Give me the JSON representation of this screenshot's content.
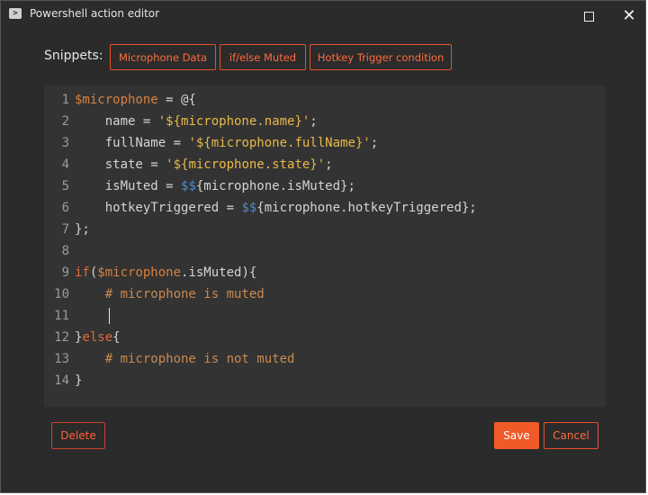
{
  "window": {
    "title": "Powershell action editor",
    "app_icon": "powershell-icon",
    "maximize_icon": "maximize-icon",
    "close_icon": "close-icon",
    "close_glyph": "✕"
  },
  "snippets": {
    "label": "Snippets:",
    "buttons": [
      "Microphone Data",
      "if/else Muted",
      "Hotkey Trigger condition"
    ]
  },
  "editor": {
    "line_numbers": [
      "1",
      "2",
      "3",
      "4",
      "5",
      "6",
      "7",
      "8",
      "9",
      "10",
      "11",
      "12",
      "13",
      "14"
    ],
    "tokens": {
      "l1_var": "$microphone",
      "l1_rest": " = @{",
      "l2_a": "    name = ",
      "l2_str": "'${microphone.name}'",
      "l2_end": ";",
      "l3_a": "    fullName = ",
      "l3_str": "'${microphone.fullName}'",
      "l3_end": ";",
      "l4_a": "    state = ",
      "l4_str": "'${microphone.state}'",
      "l4_end": ";",
      "l5_a": "    isMuted = ",
      "l5_dol": "$$",
      "l5_rest": "{microphone.isMuted};",
      "l6_a": "    hotkeyTriggered = ",
      "l6_dol": "$$",
      "l6_rest": "{microphone.hotkeyTriggered};",
      "l7": "};",
      "l8": "",
      "l9_kw": "if",
      "l9_paren": "(",
      "l9_var": "$microphone",
      "l9_rest": ".isMuted){",
      "l10": "    # microphone is muted",
      "l11": "",
      "l12_a": "}",
      "l12_kw": "else",
      "l12_b": "{",
      "l13": "    # microphone is not muted",
      "l14": "}"
    }
  },
  "footer": {
    "delete_label": "Delete",
    "save_label": "Save",
    "cancel_label": "Cancel"
  },
  "colors": {
    "accent": "#f05a28",
    "background": "#2b2b2b",
    "editor_bg": "#333333"
  }
}
